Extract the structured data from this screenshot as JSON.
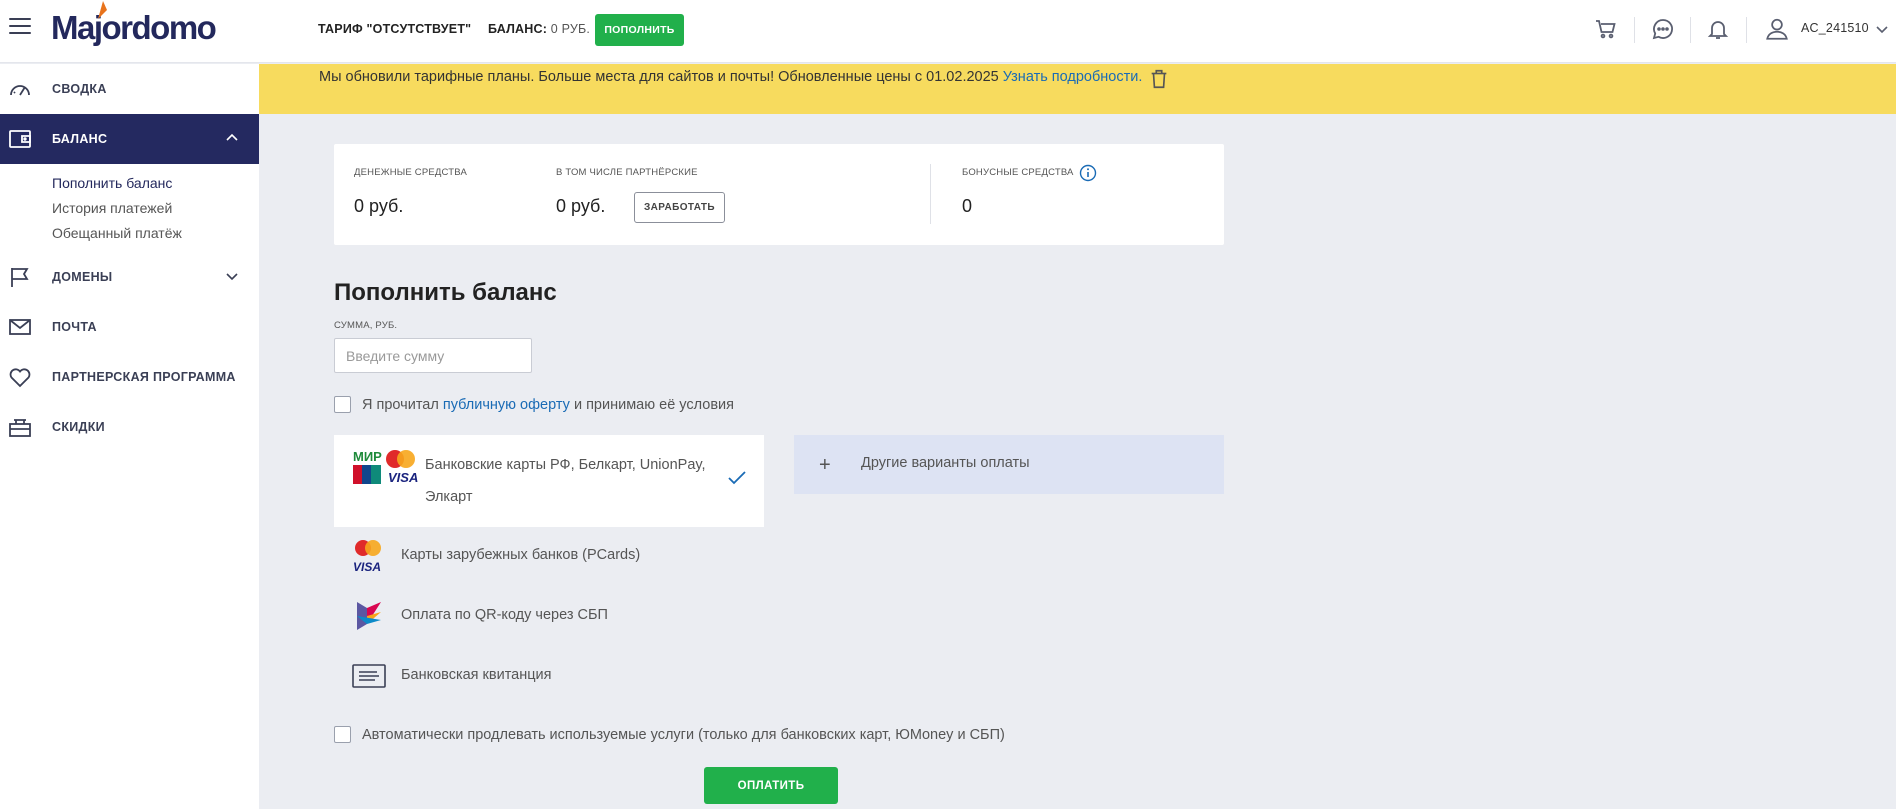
{
  "header": {
    "logo_text": "Majordomo",
    "tariff": "ТАРИФ \"ОТСУТСТВУЕТ\"",
    "balance_label": "БАЛАНС:",
    "balance_value": "0 РУБ.",
    "topup_button": "ПОПОЛНИТЬ",
    "user_name": "AC_241510",
    "icons": [
      "menu-icon",
      "cart-icon",
      "chat-icon",
      "bell-icon",
      "user-icon",
      "chevron-down-icon"
    ]
  },
  "sidebar": {
    "items": [
      {
        "label": "СВОДКА",
        "icon": "speedometer-icon"
      },
      {
        "label": "БАЛАНС",
        "icon": "wallet-icon"
      },
      {
        "label": "ДОМЕНЫ",
        "icon": "flag-icon"
      },
      {
        "label": "ПОЧТА",
        "icon": "mail-icon"
      },
      {
        "label": "ПАРТНЕРСКАЯ ПРОГРАММА",
        "icon": "heart-icon"
      },
      {
        "label": "СКИДКИ",
        "icon": "gift-icon"
      }
    ],
    "balance_sub": [
      "Пополнить баланс",
      "История платежей",
      "Обещанный платёж"
    ]
  },
  "notice": {
    "text": "Мы обновили тарифные планы. Больше места для сайтов и почты! Обновленные цены с 01.02.2025",
    "link": "Узнать подробности."
  },
  "summary": {
    "money_label": "ДЕНЕЖНЫЕ СРЕДСТВА",
    "money_value": "0 руб.",
    "partner_label": "В ТОМ ЧИСЛЕ ПАРТНЁРСКИЕ",
    "partner_value": "0 руб.",
    "earn_button": "ЗАРАБОТАТЬ",
    "bonus_label": "БОНУСНЫЕ СРЕДСТВА",
    "bonus_value": "0"
  },
  "topup": {
    "title": "Пополнить баланс",
    "amount_label": "СУММА, РУБ.",
    "amount_placeholder": "Введите сумму",
    "amount_value": "",
    "offer_prefix": "Я прочитал",
    "offer_link": "публичную оферту",
    "offer_suffix": "и принимаю её условия",
    "offer_checked": false
  },
  "payment": {
    "selected": "Банковские карты РФ, Белкарт, UnionPay, Элкарт",
    "other": "Другие варианты оплаты",
    "options": [
      "Карты зарубежных банков (PCards)",
      "Оплата по QR-коду через СБП",
      "Банковская квитанция"
    ]
  },
  "autorenew": {
    "label": "Автоматически продлевать используемые услуги (только для банковских карт, ЮMoney и СБП)",
    "checked": false
  },
  "pay_button": "ОПЛАТИТЬ",
  "colors": {
    "brand_navy": "#242960",
    "green": "#21b04b",
    "notice_yellow": "#f7db5e",
    "link_blue": "#1a6bb5",
    "selected_bg": "#dde3f3"
  }
}
